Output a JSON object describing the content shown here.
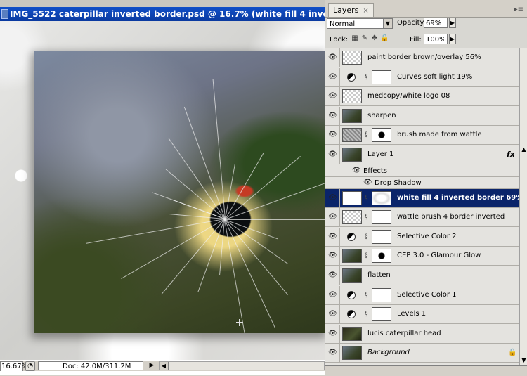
{
  "document": {
    "title": "IMG_5522 caterpillar inverted border.psd @ 16.7% (white fill 4 inverted border 69%, RG",
    "zoom": "16.67%",
    "doc_info": "Doc: 42.0M/311.2M"
  },
  "layers_panel": {
    "tab_label": "Layers",
    "tab_close": "×",
    "menu_glyph": "▸≡",
    "blend_mode": "Normal",
    "opacity_label": "Opacity:",
    "opacity_value": "69%",
    "lock_label": "Lock:",
    "fill_label": "Fill:",
    "fill_value": "100%",
    "lock_icons": [
      "lock-transparent-icon",
      "lock-image-icon",
      "lock-position-icon",
      "lock-all-icon"
    ],
    "layers": [
      {
        "name": "paint border brown/overlay 56%",
        "thumb": "checker",
        "type": "pixel"
      },
      {
        "name": "Curves soft light 19%",
        "thumb": "white",
        "type": "adjustment"
      },
      {
        "name": "medcopy/white logo 08",
        "thumb": "checker",
        "type": "pixel"
      },
      {
        "name": "sharpen",
        "thumb": "photo",
        "type": "pixel"
      },
      {
        "name": "brush made from wattle",
        "thumb": "noise",
        "mask": "mask-splat",
        "type": "masked"
      },
      {
        "name": "Layer 1",
        "thumb": "photo",
        "type": "pixel",
        "fx": "fx"
      },
      {
        "name": "white fill 4 inverted border 69%",
        "thumb": "white",
        "mask": "mask-glow",
        "type": "masked",
        "selected": true
      },
      {
        "name": "wattle brush 4 border inverted",
        "thumb": "checker",
        "mask": "white",
        "type": "masked"
      },
      {
        "name": "Selective Color 2",
        "thumb": "white",
        "type": "adjustment"
      },
      {
        "name": "CEP 3.0 - Glamour Glow",
        "thumb": "photo",
        "mask": "mask-splat",
        "type": "masked"
      },
      {
        "name": "flatten",
        "thumb": "photo",
        "type": "pixel"
      },
      {
        "name": "Selective Color 1",
        "thumb": "white",
        "type": "adjustment"
      },
      {
        "name": "Levels 1",
        "thumb": "white",
        "type": "adjustment"
      },
      {
        "name": "lucis caterpillar head",
        "thumb": "photo-dark",
        "type": "pixel"
      },
      {
        "name": "Background",
        "thumb": "photo",
        "type": "background"
      }
    ],
    "effects_label": "Effects",
    "drop_shadow_label": "Drop Shadow"
  }
}
